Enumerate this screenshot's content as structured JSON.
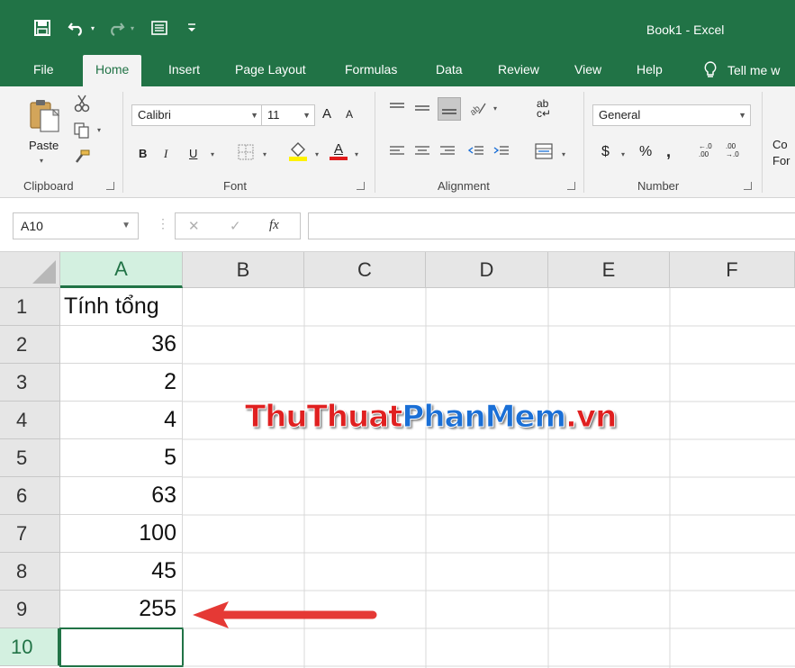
{
  "window": {
    "title": "Book1  -  Excel"
  },
  "qat": {
    "save_icon": "save-icon",
    "undo_icon": "undo-icon",
    "redo_icon": "redo-icon",
    "form_icon": "form-icon",
    "customize_icon": "customize-qat-icon"
  },
  "tabs": [
    {
      "label": "File"
    },
    {
      "label": "Home",
      "active": true
    },
    {
      "label": "Insert"
    },
    {
      "label": "Page Layout"
    },
    {
      "label": "Formulas"
    },
    {
      "label": "Data"
    },
    {
      "label": "Review"
    },
    {
      "label": "View"
    },
    {
      "label": "Help"
    }
  ],
  "tell_me": {
    "label": "Tell me w"
  },
  "ribbon": {
    "clipboard": {
      "paste_label": "Paste",
      "group_label": "Clipboard"
    },
    "font": {
      "font_name": "Calibri",
      "font_size": "11",
      "bold": "B",
      "italic": "I",
      "underline": "U",
      "grow": "A",
      "shrink": "A",
      "font_color_letter": "A",
      "group_label": "Font"
    },
    "alignment": {
      "group_label": "Alignment",
      "wrap": "ab"
    },
    "number": {
      "format": "General",
      "currency": "$",
      "percent": "%",
      "comma": ",",
      "inc_decimal": "←.0 .00",
      "dec_decimal": ".00 →.0",
      "group_label": "Number"
    },
    "styles": {
      "cond_format_line1": "Co",
      "cond_format_line2": "For"
    }
  },
  "formula_bar": {
    "name_box": "A10",
    "cancel_symbol": "✕",
    "enter_symbol": "✓",
    "fx_symbol": "fx",
    "formula": ""
  },
  "grid": {
    "columns": [
      "A",
      "B",
      "C",
      "D",
      "E",
      "F"
    ],
    "selected_column": "A",
    "rows": [
      "1",
      "2",
      "3",
      "4",
      "5",
      "6",
      "7",
      "8",
      "9",
      "10"
    ],
    "selected_row": "10",
    "column_a": [
      "Tính tổng",
      "36",
      "2",
      "4",
      "5",
      "63",
      "100",
      "45",
      "255",
      ""
    ]
  },
  "annotation": {
    "watermark_part1": "ThuThuat",
    "watermark_part2": "PhanMem",
    "watermark_part3": ".vn",
    "arrow_color": "#e53935"
  },
  "colors": {
    "excel_green": "#217346",
    "ribbon_bg": "#f3f3f3",
    "header_bg": "#e6e6e6",
    "highlight": "#fff200",
    "font_red": "#e01b1b"
  }
}
